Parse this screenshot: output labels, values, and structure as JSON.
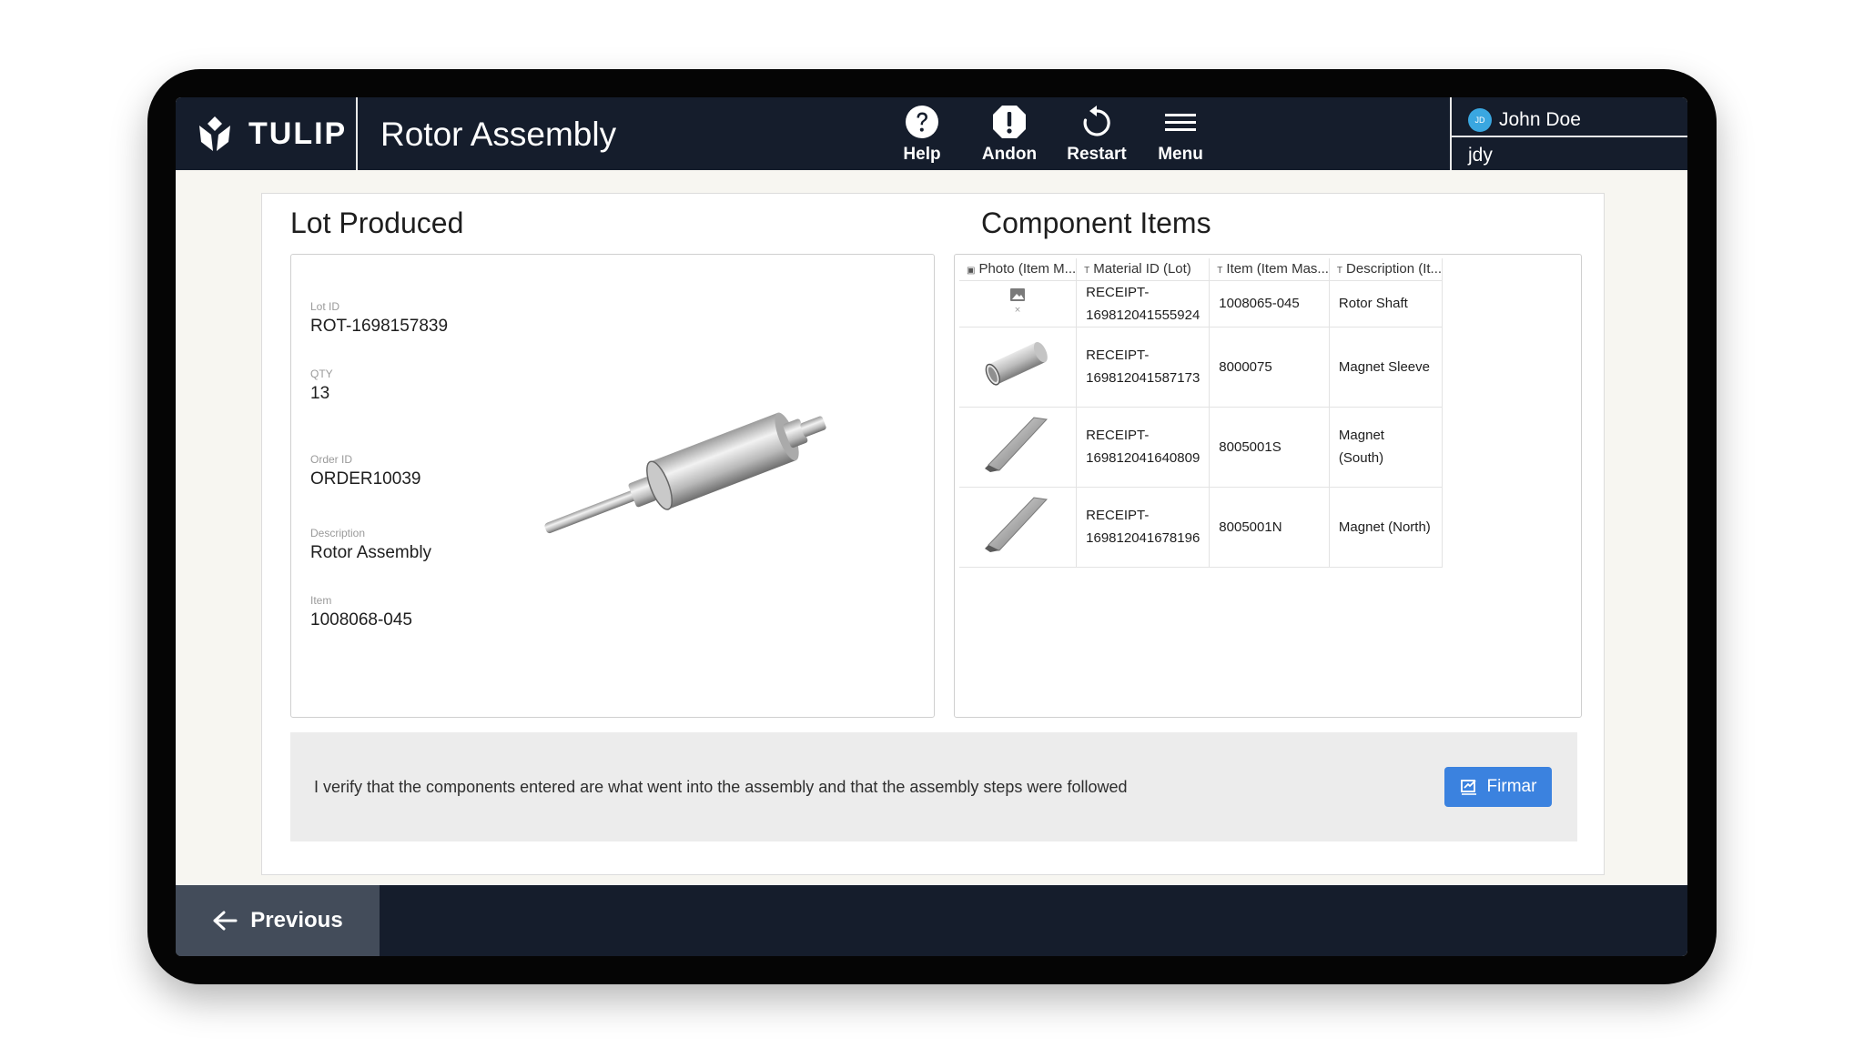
{
  "header": {
    "logo_text": "TULIP",
    "app_title": "Rotor Assembly",
    "buttons": [
      {
        "icon": "help-icon",
        "label": "Help"
      },
      {
        "icon": "andon-icon",
        "label": "Andon"
      },
      {
        "icon": "restart-icon",
        "label": "Restart"
      },
      {
        "icon": "menu-icon",
        "label": "Menu"
      }
    ],
    "user": {
      "avatar_initials": "JD",
      "name": "John Doe",
      "id": "jdy"
    }
  },
  "lot_produced": {
    "title": "Lot Produced",
    "fields": [
      {
        "label": "Lot ID",
        "value": "ROT-1698157839"
      },
      {
        "label": "QTY",
        "value": "13"
      },
      {
        "label": "Order ID",
        "value": "ORDER10039"
      },
      {
        "label": "Description",
        "value": "Rotor Assembly"
      },
      {
        "label": "Item",
        "value": "1008068-045"
      }
    ]
  },
  "component_items": {
    "title": "Component Items",
    "columns": [
      "Photo (Item M...",
      "Material ID (Lot)",
      "Item (Item Mas...",
      "Description (It..."
    ],
    "rows": [
      {
        "photo": "missing-image",
        "material_line1": "RECEIPT-",
        "material_line2": "169812041555924",
        "item": "1008065-045",
        "description": "Rotor Shaft"
      },
      {
        "photo": "sleeve",
        "material_line1": "RECEIPT-",
        "material_line2": "169812041587173",
        "item": "8000075",
        "description": "Magnet Sleeve"
      },
      {
        "photo": "magnet",
        "material_line1": "RECEIPT-",
        "material_line2": "169812041640809",
        "item": "8005001S",
        "description": "Magnet (South)"
      },
      {
        "photo": "magnet",
        "material_line1": "RECEIPT-",
        "material_line2": "169812041678196",
        "item": "8005001N",
        "description": "Magnet (North)"
      }
    ]
  },
  "verification": {
    "text": "I verify that the components entered are what went into the assembly and that the assembly steps were followed",
    "sign_label": "Firmar"
  },
  "footer": {
    "previous_label": "Previous"
  },
  "colors": {
    "header_bg": "#151d2c",
    "accent": "#3b82df",
    "avatar": "#3aa7e0"
  }
}
